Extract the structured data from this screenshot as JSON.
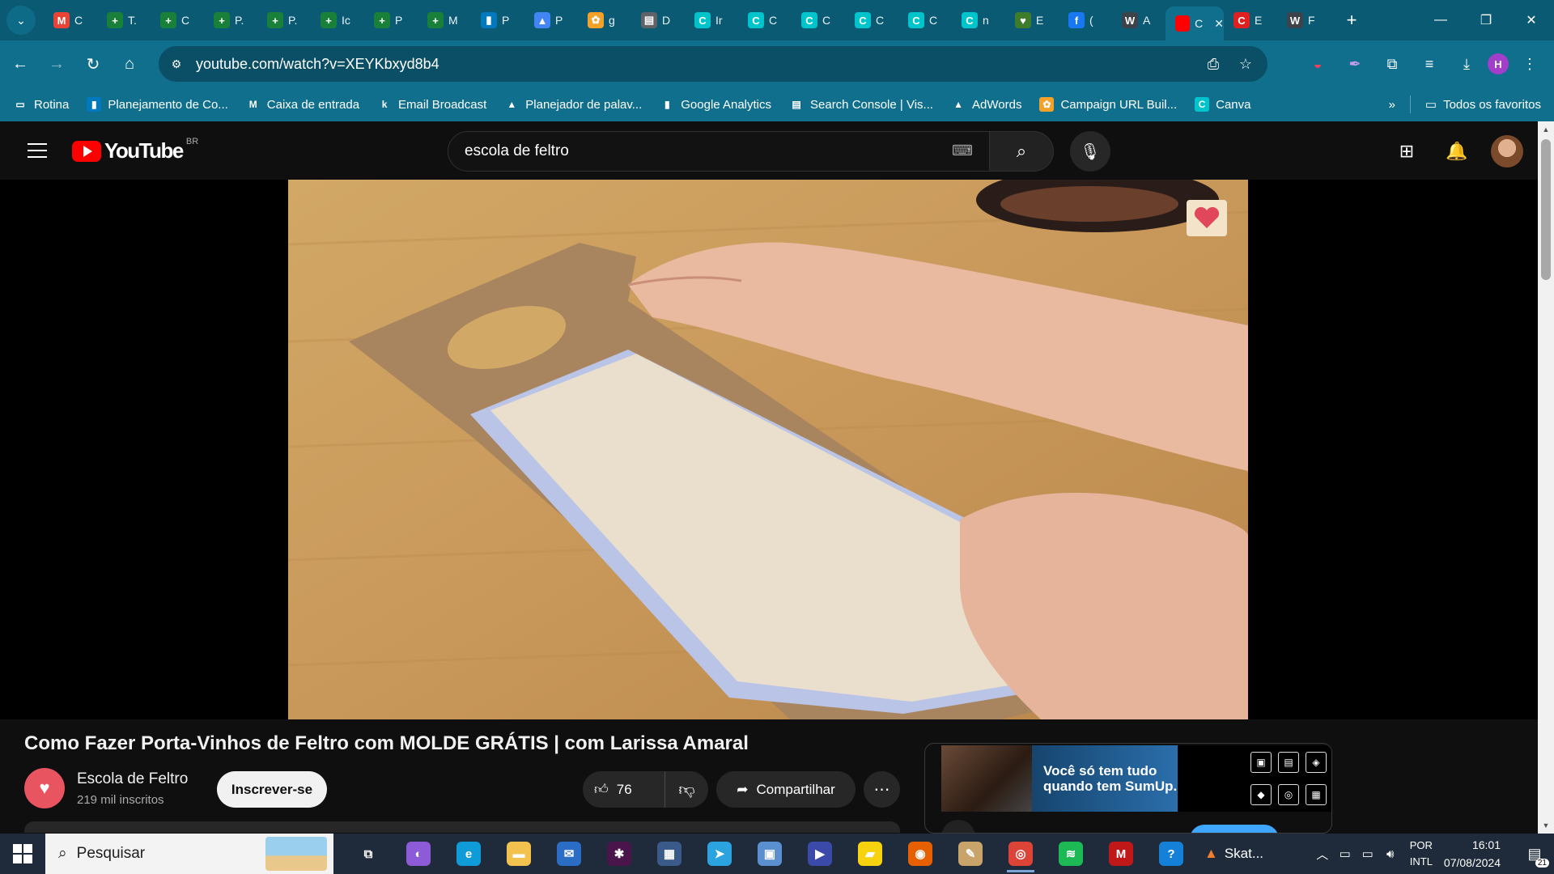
{
  "browser": {
    "tabs": [
      {
        "letter": "C",
        "icon": "gmail-icon",
        "color": "#ea4335",
        "glyph": "M"
      },
      {
        "letter": "T.",
        "icon": "sheets-icon",
        "color": "#188038",
        "glyph": "+"
      },
      {
        "letter": "C",
        "icon": "sheets-icon",
        "color": "#188038",
        "glyph": "+"
      },
      {
        "letter": "P.",
        "icon": "sheets-icon",
        "color": "#188038",
        "glyph": "+"
      },
      {
        "letter": "P.",
        "icon": "sheets-icon",
        "color": "#188038",
        "glyph": "+"
      },
      {
        "letter": "Ic",
        "icon": "sheets-icon",
        "color": "#188038",
        "glyph": "+"
      },
      {
        "letter": "P",
        "icon": "sheets-icon",
        "color": "#188038",
        "glyph": "+"
      },
      {
        "letter": "M",
        "icon": "sheets-icon",
        "color": "#188038",
        "glyph": "+"
      },
      {
        "letter": "P",
        "icon": "trello-icon",
        "color": "#0079bf",
        "glyph": "▮"
      },
      {
        "letter": "P",
        "icon": "google-ads-icon",
        "color": "#4285f4",
        "glyph": "▲"
      },
      {
        "letter": "g",
        "icon": "ga-campaign-icon",
        "color": "#f4a12a",
        "glyph": "✿"
      },
      {
        "letter": "D",
        "icon": "store-icon",
        "color": "#5f6368",
        "glyph": "▤"
      },
      {
        "letter": "Ir",
        "icon": "canva-icon",
        "color": "#00c4cc",
        "glyph": "C"
      },
      {
        "letter": "C",
        "icon": "canva-icon",
        "color": "#00c4cc",
        "glyph": "C"
      },
      {
        "letter": "C",
        "icon": "canva-icon",
        "color": "#00c4cc",
        "glyph": "C"
      },
      {
        "letter": "C",
        "icon": "canva-icon",
        "color": "#00c4cc",
        "glyph": "C"
      },
      {
        "letter": "C",
        "icon": "canva-icon",
        "color": "#00c4cc",
        "glyph": "C"
      },
      {
        "letter": "n",
        "icon": "canva-icon",
        "color": "#00c4cc",
        "glyph": "C"
      },
      {
        "letter": "E",
        "icon": "heart-icon",
        "color": "#3e7b2a",
        "glyph": "♥"
      },
      {
        "letter": "(",
        "icon": "facebook-icon",
        "color": "#1877f2",
        "glyph": "f"
      },
      {
        "letter": "A",
        "icon": "wordpress-icon",
        "color": "#3c434a",
        "glyph": "W"
      },
      {
        "letter": "C",
        "icon": "youtube-tab-icon",
        "color": "#ff0000",
        "glyph": "",
        "active": true,
        "close": "✕"
      },
      {
        "letter": "E",
        "icon": "red-square-icon",
        "color": "#e02020",
        "glyph": "C"
      },
      {
        "letter": "F",
        "icon": "wordpress-icon",
        "color": "#3c434a",
        "glyph": "W"
      }
    ],
    "new_tab": "+",
    "url": "youtube.com/watch?v=XEYKbxyd8b4",
    "bookmarks": [
      {
        "label": "Rotina",
        "icon": "folder-icon",
        "color": "transparent",
        "glyph": "▭"
      },
      {
        "label": "Planejamento de Co...",
        "icon": "trello-icon",
        "color": "#0079bf",
        "glyph": "▮"
      },
      {
        "label": "Caixa de entrada",
        "icon": "gmail-icon",
        "color": "transparent",
        "glyph": "M"
      },
      {
        "label": "Email Broadcast",
        "icon": "kajabi-icon",
        "color": "transparent",
        "glyph": "k"
      },
      {
        "label": "Planejador de palav...",
        "icon": "google-ads-icon",
        "color": "transparent",
        "glyph": "▲"
      },
      {
        "label": "Google Analytics",
        "icon": "analytics-icon",
        "color": "transparent",
        "glyph": "▮"
      },
      {
        "label": "Search Console | Vis...",
        "icon": "search-console-icon",
        "color": "transparent",
        "glyph": "▤"
      },
      {
        "label": "AdWords",
        "icon": "google-ads-icon",
        "color": "transparent",
        "glyph": "▲"
      },
      {
        "label": "Campaign URL Buil...",
        "icon": "ga-campaign-icon",
        "color": "#f4a12a",
        "glyph": "✿"
      },
      {
        "label": "Canva",
        "icon": "canva-icon",
        "color": "#00c4cc",
        "glyph": "C"
      }
    ],
    "bookmarks_more": "»",
    "all_bookmarks": "Todos os favoritos",
    "profile_letter": "H"
  },
  "youtube": {
    "country_code": "BR",
    "logo_word": "YouTube",
    "search_value": "escola de feltro",
    "video_title": "Como Fazer Porta-Vinhos de Feltro com MOLDE GRÁTIS | com Larissa Amaral",
    "channel_name": "Escola de Feltro",
    "subscribers": "219 mil inscritos",
    "subscribe_label": "Inscrever-se",
    "like_count": "76",
    "share_label": "Compartilhar",
    "ad_text": "Você só tem tudo quando tem SumUp."
  },
  "taskbar": {
    "search_placeholder": "Pesquisar",
    "weather_label": "Skat...",
    "lang_1": "POR",
    "lang_2": "INTL",
    "time": "16:01",
    "date": "07/08/2024",
    "notifications": "21",
    "apps": [
      {
        "name": "task-view-icon",
        "color": "transparent",
        "glyph": "⧉"
      },
      {
        "name": "copilot-icon",
        "color": "#8e5bd8",
        "glyph": "◐"
      },
      {
        "name": "edge-icon",
        "color": "#0f9bd7",
        "glyph": "e"
      },
      {
        "name": "file-explorer-icon",
        "color": "#f2c14e",
        "glyph": "▬"
      },
      {
        "name": "mail-icon",
        "color": "#2b6cc4",
        "glyph": "✉"
      },
      {
        "name": "slack-icon",
        "color": "#4a154b",
        "glyph": "✱"
      },
      {
        "name": "calculator-icon",
        "color": "#3a5a8a",
        "glyph": "▦"
      },
      {
        "name": "telegram-icon",
        "color": "#2aa3df",
        "glyph": "➤"
      },
      {
        "name": "photos-icon",
        "color": "#5a8fd0",
        "glyph": "▣"
      },
      {
        "name": "video-editor-icon",
        "color": "#3b4aa8",
        "glyph": "▶"
      },
      {
        "name": "sticky-notes-icon",
        "color": "#f7d20e",
        "glyph": "▰"
      },
      {
        "name": "firefox-icon",
        "color": "#e66000",
        "glyph": "◉"
      },
      {
        "name": "paint-icon",
        "color": "#c8a36a",
        "glyph": "✎"
      },
      {
        "name": "chrome-icon",
        "color": "#db4437",
        "glyph": "◎",
        "active": true
      },
      {
        "name": "spotify-icon",
        "color": "#1db954",
        "glyph": "≋"
      },
      {
        "name": "mcafee-icon",
        "color": "#c01818",
        "glyph": "M"
      },
      {
        "name": "help-icon",
        "color": "#1580d8",
        "glyph": "?"
      }
    ]
  }
}
